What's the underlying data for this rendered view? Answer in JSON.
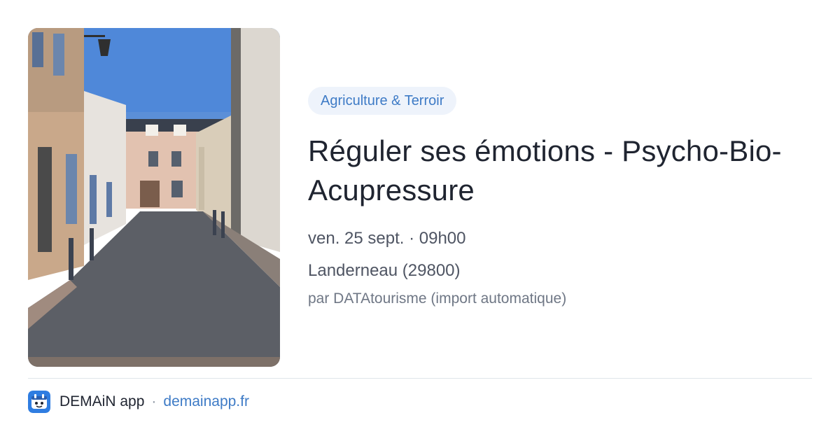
{
  "card": {
    "photo": {
      "icon": "street-photo"
    },
    "category_badge": "Agriculture & Terroir",
    "title": "Réguler ses émotions - Psycho-Bio-Acupressure",
    "datetime": "ven. 25 sept. · 09h00",
    "location": "Landerneau (29800)",
    "source": "par DATAtourisme (import automatique)"
  },
  "footer": {
    "logo_icon": "demain-app-logo-icon",
    "app_name": "DEMAiN app",
    "separator": "·",
    "site": "demainapp.fr"
  },
  "colors": {
    "accent": "#3e7bc6",
    "badge_bg": "#eef3fb",
    "title": "#1f2430",
    "muted": "#4f5563",
    "divider": "#dfe5ea"
  }
}
